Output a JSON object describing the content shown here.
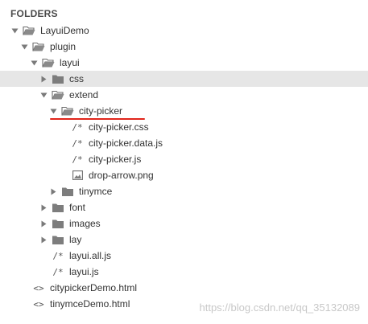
{
  "header": {
    "title": "FOLDERS"
  },
  "tree": {
    "root": {
      "label": "LayuiDemo"
    },
    "plugin": {
      "label": "plugin"
    },
    "layui": {
      "label": "layui"
    },
    "css": {
      "label": "css"
    },
    "extend": {
      "label": "extend"
    },
    "city_picker": {
      "label": "city-picker"
    },
    "city_picker_css": {
      "label": "city-picker.css",
      "icon": "/*"
    },
    "city_picker_data_js": {
      "label": "city-picker.data.js",
      "icon": "/*"
    },
    "city_picker_js": {
      "label": "city-picker.js",
      "icon": "/*"
    },
    "drop_arrow_png": {
      "label": "drop-arrow.png",
      "icon": "image-icon"
    },
    "tinymce": {
      "label": "tinymce"
    },
    "font": {
      "label": "font"
    },
    "images": {
      "label": "images"
    },
    "lay": {
      "label": "lay"
    },
    "layui_all_js": {
      "label": "layui.all.js",
      "icon": "/*"
    },
    "layui_js": {
      "label": "layui.js",
      "icon": "/*"
    },
    "citypicker_demo_html": {
      "label": "citypickerDemo.html",
      "icon": "<>"
    },
    "tinymce_demo_html": {
      "label": "tinymceDemo.html",
      "icon": "<>"
    }
  },
  "selected_row": "css",
  "highlight_color": "#e1251b",
  "watermark": {
    "text": "https://blog.csdn.net/qq_35132089"
  }
}
